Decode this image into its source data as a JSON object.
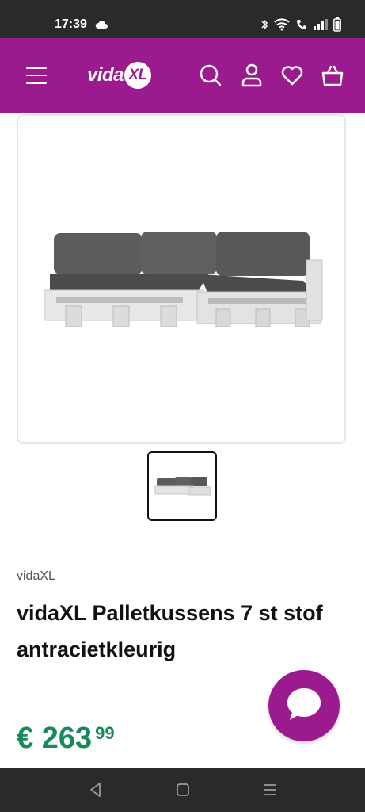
{
  "status_bar": {
    "time": "17:39"
  },
  "header": {
    "logo_text": "vida",
    "logo_badge": "XL",
    "brand_color": "#9b1b8e"
  },
  "product": {
    "brand": "vidaXL",
    "title": "vidaXL Palletkussens 7 st stof antracietkleurig",
    "price_main": "€ 263",
    "price_cents": "99",
    "price_color": "#178a5a"
  },
  "icons": {
    "menu": "hamburger-menu-icon",
    "search": "search-icon",
    "account": "user-icon",
    "wishlist": "heart-icon",
    "cart": "basket-icon",
    "chat": "chat-bubble-icon"
  }
}
